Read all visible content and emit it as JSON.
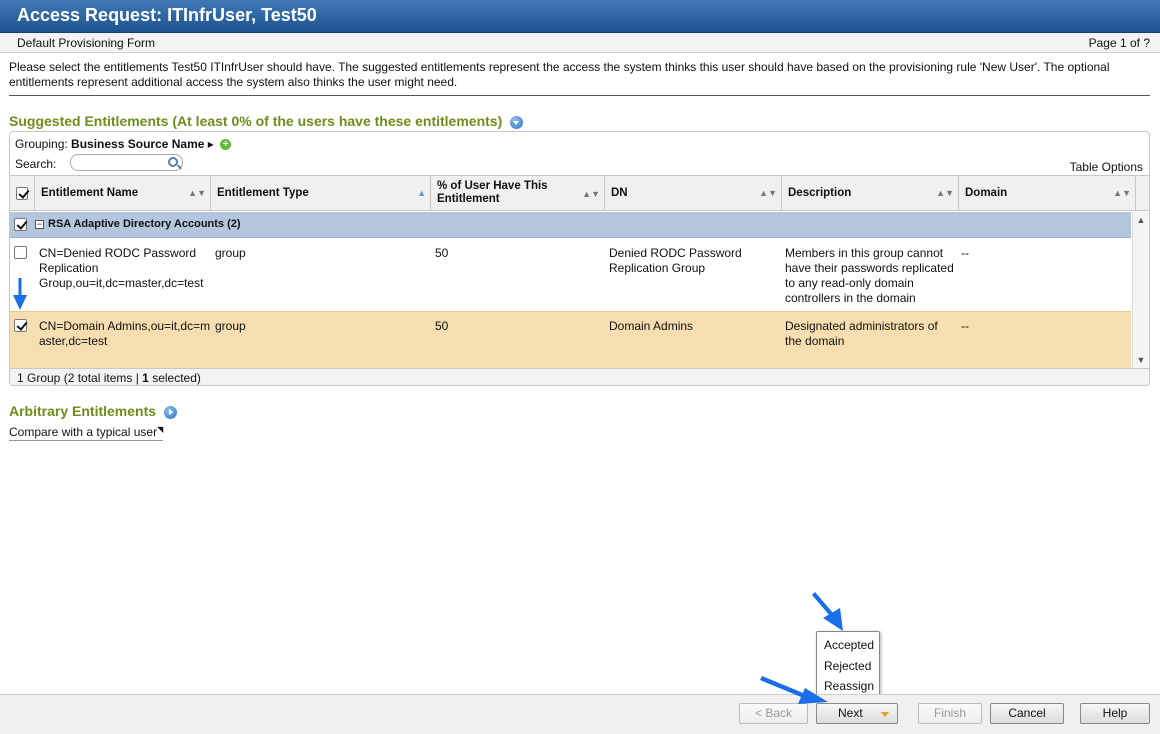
{
  "window": {
    "title": "Access Request: ITInfrUser, Test50"
  },
  "form": {
    "name": "Default Provisioning Form",
    "page_info": "Page 1 of ?"
  },
  "instructions": "Please select the entitlements Test50 ITInfrUser should have. The suggested entitlements represent the access the system thinks this user should have based on the provisioning rule 'New User'. The optional entitlements represent additional access the system also thinks the user might need.",
  "suggested": {
    "title": "Suggested Entitlements (At least 0% of the users have these entitlements)",
    "grouping_label": "Grouping:",
    "grouping_value": "Business Source Name",
    "grouping_arrow": "▸",
    "search_label": "Search:",
    "search_value": "",
    "table_options": "Table Options",
    "columns": {
      "name": "Entitlement Name",
      "type": "Entitlement Type",
      "percent": "% of User Have This Entitlement",
      "dn": "DN",
      "description": "Description",
      "domain": "Domain"
    },
    "group": {
      "label": "RSA Adaptive Directory Accounts (2)",
      "checked": true
    },
    "rows": [
      {
        "checked": false,
        "name": "CN=Denied RODC Password Replication Group,ou=it,dc=master,dc=test",
        "type": "group",
        "percent": "50",
        "dn": "Denied RODC Password Replication Group",
        "description": "Members in this group cannot have their passwords replicated to any read-only domain controllers in the domain",
        "domain": "--"
      },
      {
        "checked": true,
        "name": "CN=Domain Admins,ou=it,dc=master,dc=test",
        "type": "group",
        "percent": "50",
        "dn": "Domain Admins",
        "description": "Designated administrators of the domain",
        "domain": "--"
      }
    ],
    "footer_prefix": "1 Group (2 total items | ",
    "footer_selected_count": "1",
    "footer_suffix": " selected)"
  },
  "arbitrary": {
    "title": "Arbitrary Entitlements",
    "compare_link": "Compare with a typical user"
  },
  "buttons": {
    "back": "< Back",
    "next": "Next",
    "finish": "Finish",
    "cancel": "Cancel",
    "help": "Help"
  },
  "next_menu": [
    "Accepted",
    "Rejected",
    "Reassign"
  ],
  "colors": {
    "title_bar": "#2b64a0",
    "section_title": "#6b8f1a",
    "group_row": "#b4c6de",
    "selected_row": "#f6deb0",
    "annotation_arrow": "#1a6fe8"
  },
  "icons": [
    "expand-icon",
    "add-grouping-icon",
    "search-icon",
    "collapse-group-icon",
    "sort-icon",
    "external-link-icon",
    "dropdown-arrow-icon"
  ]
}
